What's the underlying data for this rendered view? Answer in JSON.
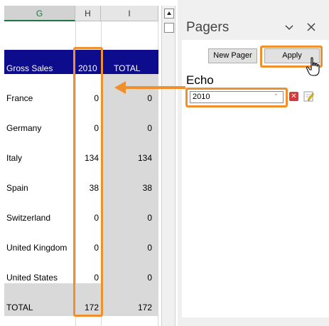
{
  "spreadsheet": {
    "column_headers": [
      "G",
      "H",
      "I"
    ],
    "header_row": {
      "label": "Gross Sales",
      "year": "2010",
      "total": "TOTAL"
    },
    "rows": [
      {
        "label": "France",
        "h": "0",
        "i": "0"
      },
      {
        "label": "Germany",
        "h": "0",
        "i": "0"
      },
      {
        "label": "Italy",
        "h": "134",
        "i": "134"
      },
      {
        "label": "Spain",
        "h": "38",
        "i": "38"
      },
      {
        "label": "Switzerland",
        "h": "0",
        "i": "0"
      },
      {
        "label": "United Kingdom",
        "h": "0",
        "i": "0"
      },
      {
        "label": "United States",
        "h": "0",
        "i": "0"
      }
    ],
    "total_row": {
      "label": "TOTAL",
      "h": "172",
      "i": "172"
    }
  },
  "pane": {
    "title": "Pagers",
    "chevron_icon": "chevron-down-icon",
    "close_icon": "close-icon",
    "new_pager_label": "New Pager",
    "apply_label": "Apply",
    "pager_name": "Echo",
    "pager_value": "2010",
    "delete_icon": "delete-icon",
    "edit_icon": "edit-icon"
  },
  "colors": {
    "highlight": "#f0902d",
    "header_band": "#0c0c8c",
    "gray_fill": "#d9d9d9",
    "selected_column_text": "#217346"
  }
}
